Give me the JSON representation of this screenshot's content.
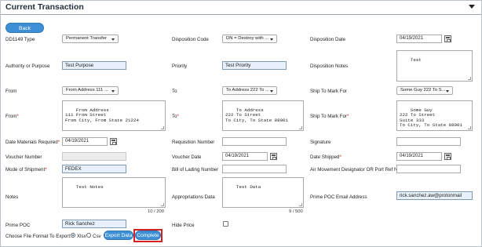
{
  "header": {
    "title": "Current Transaction"
  },
  "back_label": "Back",
  "labels": {
    "dd1149_type": "DD1149 Type",
    "disposition_code": "Disposition Code",
    "disposition_date": "Disposition Date",
    "authority": "Authority or Purpose",
    "priority": "Priority",
    "disposition_notes": "Disposition Notes",
    "from_select": "From",
    "to_select": "To",
    "ship_to_mark_for_select": "Ship To Mark For",
    "from_addr": "From",
    "to_addr": "To",
    "ship_to_mark_for_addr": "Ship To Mark For",
    "date_materials_required": "Date Materials Required",
    "requisition_number": "Requisition Number",
    "signature": "Signature",
    "voucher_number": "Voucher Number",
    "voucher_date": "Voucher Date",
    "date_shipped": "Date Shipped",
    "mode_of_shipment": "Mode of Shipment",
    "bill_of_lading": "Bill of Lading Number",
    "air_movement": "Air Movement Designator OR Port Ref No",
    "notes": "Notes",
    "appropriations_data": "Appropriations Data",
    "prime_poc_email": "Prime POC Email Address",
    "prime_poc": "Prime POC",
    "hide_price": "Hide Price",
    "choose_format": "Choose File Format To Export:",
    "xlsx": "Xlsx",
    "csv": "Csv"
  },
  "required_mark": "*",
  "values": {
    "dd1149_type": "Permanent Transfer",
    "disposition_code": "DN = Destroy with ...",
    "disposition_date": "04/19/2021",
    "authority": "Test Purpose",
    "priority": "Test Priority",
    "disposition_notes": "Test",
    "from_select": "From Address 111 ...",
    "to_select": "To Address 222 To ...",
    "ship_to_mark_for_select": "Some Guy 222 To S...",
    "from_addr": "From Address\n111 From Street\nFrom City, From State 21224",
    "to_addr": "To Address\n222 To Street\nTo City, To State 88901",
    "ship_to_mark_for_addr": "Some Guy\n222 To Street\nSuite 333\nTo City, To State 88901",
    "date_materials_required": "04/19/2021",
    "requisition_number": "",
    "signature": "",
    "voucher_number": "",
    "voucher_date": "04/19/2021",
    "date_shipped": "04/19/2021",
    "mode_of_shipment": "FEDEX",
    "bill_of_lading": "",
    "air_movement": "",
    "notes": "Test Notes",
    "notes_count": "10 / 200",
    "appropriations_data": "Test Data",
    "appropriations_count": "9 / 500",
    "prime_poc_email": "rick.sanchez.aw@protonmail",
    "prime_poc": "Rick Sanchez"
  },
  "buttons": {
    "export": "Export Data",
    "complete": "Complete"
  },
  "colors": {
    "accent": "#3d8fd6",
    "required": "#d22222",
    "highlight": "#d32020",
    "field_highlight": "#e7f0fb"
  }
}
